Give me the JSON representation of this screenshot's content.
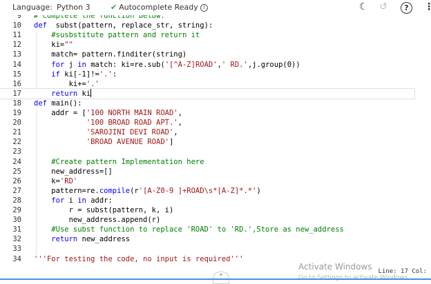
{
  "toolbar": {
    "language_label": "Language:",
    "language_value": "Python 3",
    "autocomplete_status": "Autocomplete Ready",
    "help_label": "?",
    "more_label": "⋮"
  },
  "editor": {
    "lines": [
      {
        "n": "9",
        "segs": [
          [
            "cmt",
            "# Complete the function below."
          ]
        ]
      },
      {
        "n": "10",
        "segs": [
          [
            "kw",
            "def"
          ],
          [
            "",
            "  subst(pattern, replace_str, string):"
          ]
        ]
      },
      {
        "n": "11",
        "segs": [
          [
            "",
            "    "
          ],
          [
            "cmt",
            "#susbstitute pattern and return it"
          ]
        ]
      },
      {
        "n": "12",
        "segs": [
          [
            "",
            "    ki="
          ],
          [
            "str",
            "\"\""
          ]
        ]
      },
      {
        "n": "13",
        "segs": [
          [
            "",
            "    match= pattern.finditer(string)"
          ]
        ]
      },
      {
        "n": "14",
        "segs": [
          [
            "",
            "    "
          ],
          [
            "kw",
            "for"
          ],
          [
            "",
            " j "
          ],
          [
            "kw",
            "in"
          ],
          [
            "",
            " match: ki=re.sub("
          ],
          [
            "str",
            "'[^A-Z]ROAD'"
          ],
          [
            "",
            ","
          ],
          [
            "str",
            "' RD.'"
          ],
          [
            "",
            ",j.group(0))"
          ]
        ]
      },
      {
        "n": "15",
        "segs": [
          [
            "",
            "    "
          ],
          [
            "kw",
            "if"
          ],
          [
            "",
            " ki[-1]!="
          ],
          [
            "str",
            "'.'"
          ],
          [
            "",
            ":"
          ]
        ]
      },
      {
        "n": "16",
        "segs": [
          [
            "",
            "        ki+="
          ],
          [
            "str",
            "'.'"
          ]
        ]
      },
      {
        "n": "17",
        "segs": [
          [
            "",
            "    "
          ],
          [
            "kw",
            "return"
          ],
          [
            "",
            " ki"
          ]
        ],
        "current": true
      },
      {
        "n": "18",
        "segs": [
          [
            "kw",
            "def"
          ],
          [
            "",
            " main():"
          ]
        ]
      },
      {
        "n": "19",
        "segs": [
          [
            "",
            "    addr = ["
          ],
          [
            "str",
            "'100 NORTH MAIN ROAD'"
          ],
          [
            "",
            ","
          ]
        ]
      },
      {
        "n": "20",
        "segs": [
          [
            "",
            "            "
          ],
          [
            "str",
            "'100 BROAD ROAD APT.'"
          ],
          [
            "",
            ","
          ]
        ]
      },
      {
        "n": "21",
        "segs": [
          [
            "",
            "            "
          ],
          [
            "str",
            "'SAROJINI DEVI ROAD'"
          ],
          [
            "",
            ","
          ]
        ]
      },
      {
        "n": "22",
        "segs": [
          [
            "",
            "            "
          ],
          [
            "str",
            "'BROAD AVENUE ROAD'"
          ],
          [
            "",
            "]"
          ]
        ]
      },
      {
        "n": "23",
        "segs": [
          [
            "",
            ""
          ]
        ]
      },
      {
        "n": "24",
        "segs": [
          [
            "",
            "    "
          ],
          [
            "cmt",
            "#Create pattern Implementation here"
          ]
        ]
      },
      {
        "n": "25",
        "segs": [
          [
            "",
            "    new_address=[]"
          ]
        ]
      },
      {
        "n": "26",
        "segs": [
          [
            "",
            "    k="
          ],
          [
            "str",
            "'RD'"
          ]
        ]
      },
      {
        "n": "27",
        "segs": [
          [
            "",
            "    pattern=re."
          ],
          [
            "builtin",
            "compile"
          ],
          [
            "",
            "(r"
          ],
          [
            "str",
            "'[A-Z0-9 ]+ROAD\\s*[A-Z]*.*'"
          ],
          [
            "",
            ")"
          ]
        ]
      },
      {
        "n": "28",
        "segs": [
          [
            "",
            "    "
          ],
          [
            "kw",
            "for"
          ],
          [
            "",
            " i "
          ],
          [
            "kw",
            "in"
          ],
          [
            "",
            " addr:"
          ]
        ]
      },
      {
        "n": "29",
        "segs": [
          [
            "",
            "        r = subst(pattern, k, i)"
          ]
        ]
      },
      {
        "n": "30",
        "segs": [
          [
            "",
            "        new_address.append(r)"
          ]
        ]
      },
      {
        "n": "31",
        "segs": [
          [
            "",
            "    "
          ],
          [
            "cmt",
            "#Use subst function to replace 'ROAD' to 'RD.',Store as new_address"
          ]
        ]
      },
      {
        "n": "32",
        "segs": [
          [
            "",
            "    "
          ],
          [
            "kw",
            "return"
          ],
          [
            "",
            " new_address"
          ]
        ]
      },
      {
        "n": "33",
        "segs": [
          [
            "",
            ""
          ]
        ]
      },
      {
        "n": "34",
        "segs": [
          [
            "str",
            "'''For testing the code, no input is required'''"
          ]
        ]
      }
    ]
  },
  "status": {
    "activate_title": "Activate Windows",
    "activate_sub": "Go to Settings to activate Windows.",
    "position": "Line: 17 Col:"
  },
  "colors": {
    "keyword": "#0000ff",
    "string": "#a31515",
    "comment": "#008000",
    "accent": "#4a8fd6"
  }
}
